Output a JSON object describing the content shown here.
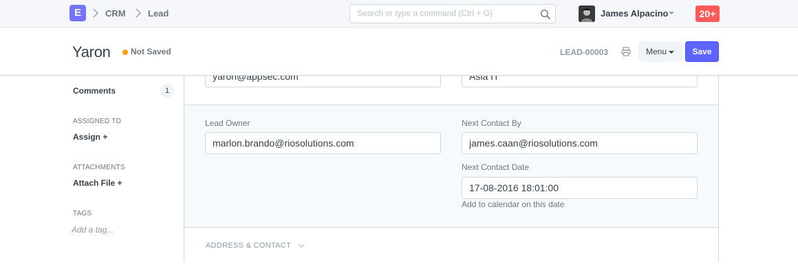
{
  "navbar": {
    "logo": "E",
    "breadcrumbs": [
      "CRM",
      "Lead"
    ],
    "search_placeholder": "Search or type a command (Ctrl + G)",
    "user_name": "James Alpacino",
    "notifications": "20+"
  },
  "page_head": {
    "title": "Yaron",
    "status": "Not Saved",
    "doc_name": "LEAD-00003",
    "menu_label": "Menu",
    "save_label": "Save"
  },
  "sidebar": {
    "comments_label": "Comments",
    "comments_count": "1",
    "assigned_head": "ASSIGNED TO",
    "assign_link": "Assign +",
    "attachments_head": "ATTACHMENTS",
    "attach_link": "Attach File +",
    "tags_head": "TAGS",
    "tag_placeholder": "Add a tag..."
  },
  "form": {
    "top_left_value": "yaron@appsec.com",
    "top_right_value": "Asia IT",
    "lead_owner_label": "Lead Owner",
    "lead_owner_value": "marlon.brando@riosolutions.com",
    "next_contact_by_label": "Next Contact By",
    "next_contact_by_value": "james.caan@riosolutions.com",
    "next_contact_date_label": "Next Contact Date",
    "next_contact_date_value": "17-08-2016 18:01:00",
    "next_contact_date_help": "Add to calendar on this date",
    "address_section": "ADDRESS & CONTACT"
  },
  "colors": {
    "primary": "#5e64ff",
    "logo": "#7574ff",
    "notification": "#ff5858",
    "status_dot": "#ffa00a"
  }
}
